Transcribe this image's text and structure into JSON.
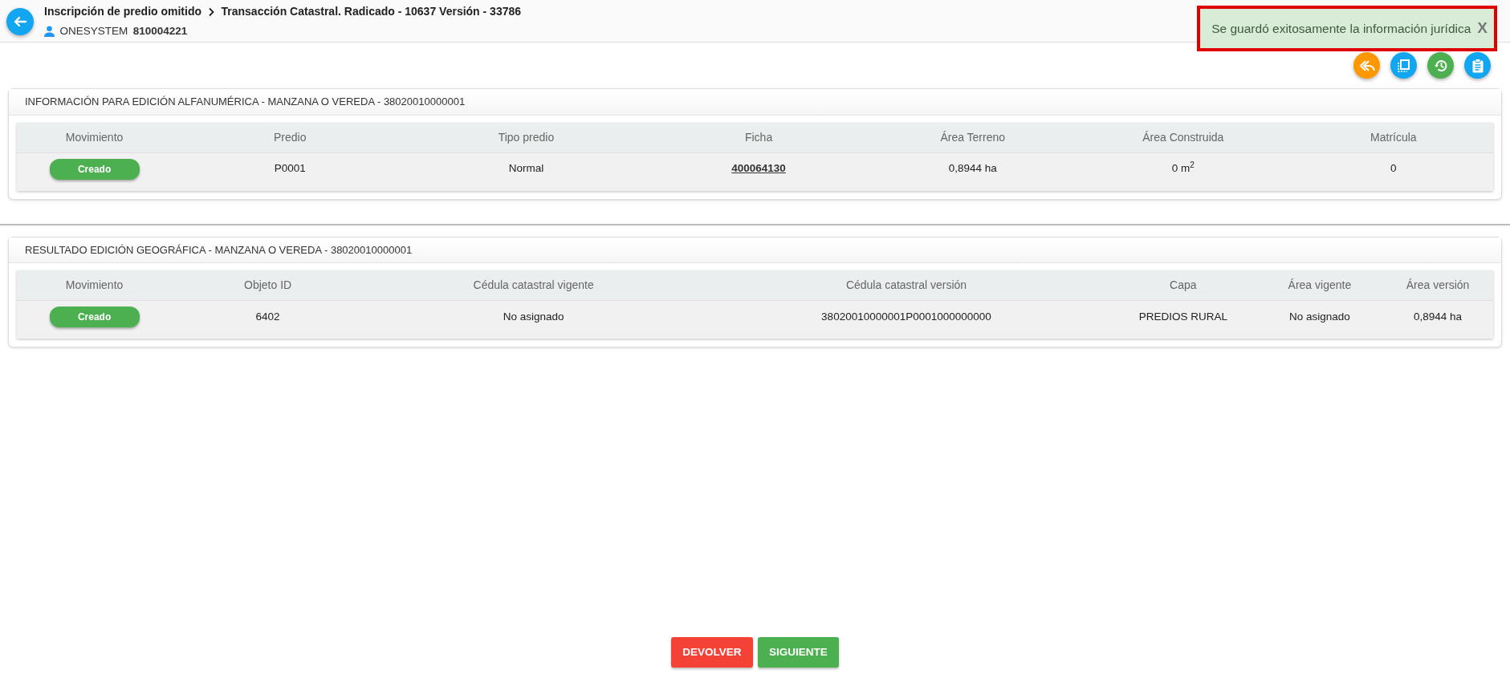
{
  "header": {
    "breadcrumb": [
      "Inscripción de predio omitido",
      "Transacción Catastral. Radicado - 10637 Versión - 33786"
    ],
    "user": {
      "name": "ONESYSTEM",
      "id": "810004221"
    }
  },
  "toast": {
    "message": "Se guardó exitosamente la información jurídica",
    "close": "X"
  },
  "panels": [
    {
      "title": "INFORMACIÓN PARA EDICIÓN ALFANUMÉRICA - MANZANA O VEREDA - 38020010000001",
      "columns": [
        "Movimiento",
        "Predio",
        "Tipo predio",
        "Ficha",
        "Área Terreno",
        "Área Construida",
        "Matrícula"
      ],
      "rows": [
        [
          {
            "kind": "status",
            "text": "Creado"
          },
          {
            "kind": "text",
            "text": "P0001"
          },
          {
            "kind": "text",
            "text": "Normal"
          },
          {
            "kind": "link",
            "text": "400064130"
          },
          {
            "kind": "text",
            "text": "0,8944 ha"
          },
          {
            "kind": "text",
            "text": "0 m$^{2}$"
          },
          {
            "kind": "text",
            "text": "0"
          }
        ]
      ]
    },
    {
      "title": "RESULTADO EDICIÓN GEOGRÁFICA - MANZANA O VEREDA - 38020010000001",
      "columns": [
        "Movimiento",
        "Objeto ID",
        "Cédula catastral vigente",
        "Cédula catastral versión",
        "Capa",
        "Área vigente",
        "Área versión"
      ],
      "rows": [
        [
          {
            "kind": "status",
            "text": "Creado"
          },
          {
            "kind": "text",
            "text": "6402"
          },
          {
            "kind": "text",
            "text": "No asignado"
          },
          {
            "kind": "text",
            "text": "38020010000001P0001000000000"
          },
          {
            "kind": "text",
            "text": "PREDIOS RURAL"
          },
          {
            "kind": "text",
            "text": "No asignado"
          },
          {
            "kind": "text",
            "text": "0,8944 ha"
          }
        ]
      ]
    }
  ],
  "footer_buttons": [
    {
      "label": "DEVOLVER",
      "kind": "danger"
    },
    {
      "label": "SIGUIENTE",
      "kind": "success"
    }
  ]
}
